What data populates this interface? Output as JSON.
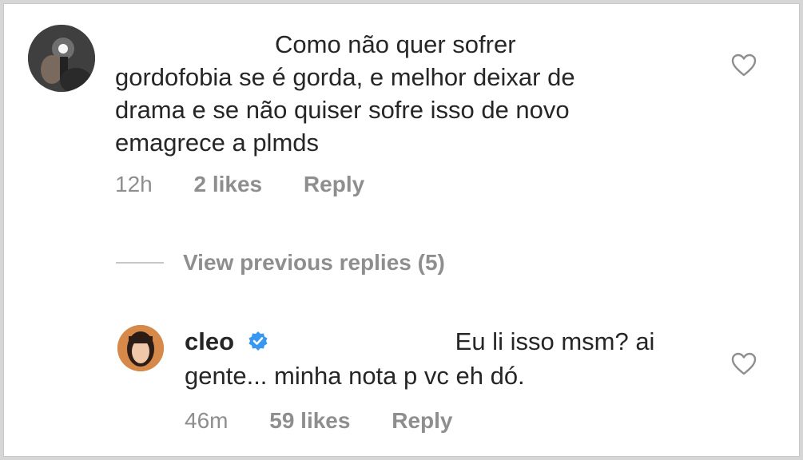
{
  "comment1": {
    "text_line1": "Como não quer sofrer",
    "text_line2": "gordofobia se é gorda, e melhor deixar de",
    "text_line3": "drama e se não quiser sofre isso de novo",
    "text_line4": "emagrece a plmds",
    "time": "12h",
    "likes": "2 likes",
    "reply": "Reply"
  },
  "view_replies": {
    "label": "View previous replies (5)"
  },
  "comment2": {
    "username": "cleo",
    "text_line1": "Eu li isso msm? ai",
    "text_line2": "gente... minha nota p vc eh dó.",
    "time": "46m",
    "likes": "59 likes",
    "reply": "Reply"
  },
  "icons": {
    "heart": "heart-outline-icon",
    "verified": "verified-badge-icon",
    "avatar": "user-avatar"
  },
  "colors": {
    "text": "#262626",
    "secondary": "#8e8e8e",
    "verified": "#3897f0"
  }
}
